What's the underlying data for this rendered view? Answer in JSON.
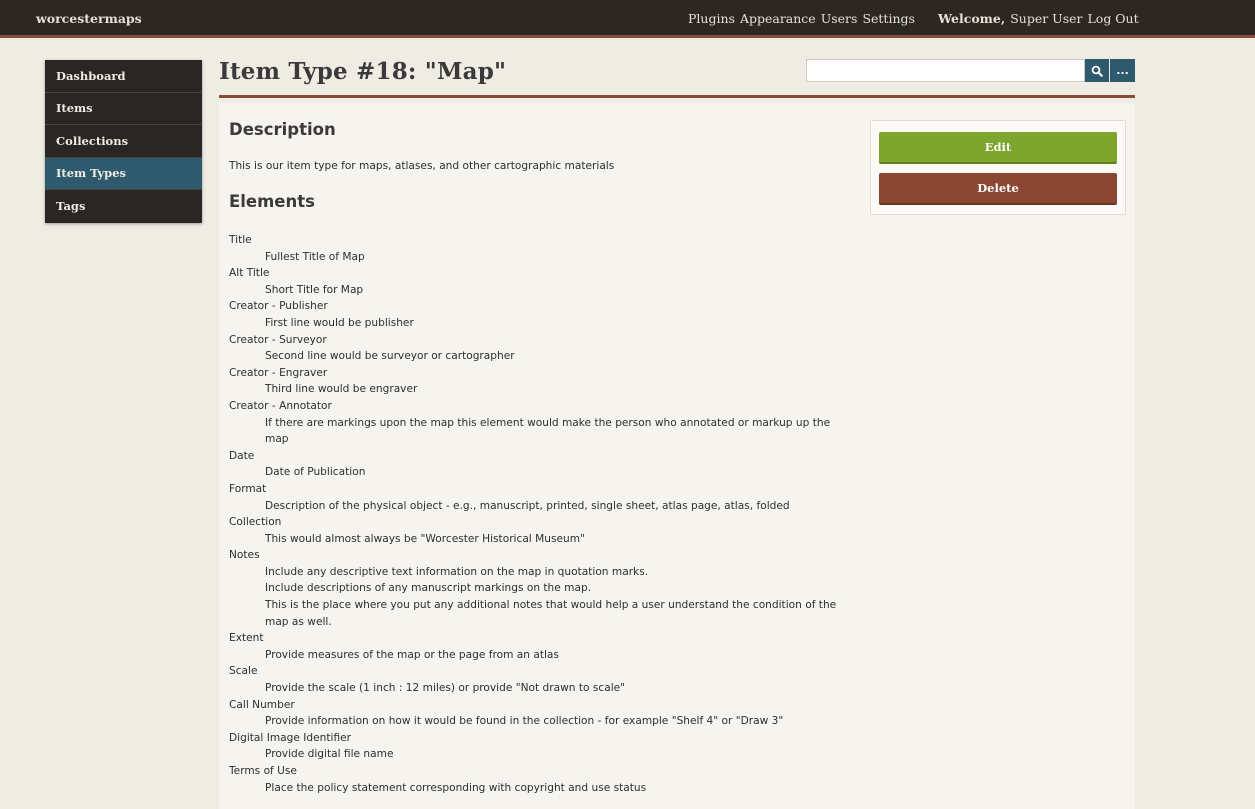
{
  "topbar": {
    "site_title": "worcestermaps",
    "nav": [
      "Plugins",
      "Appearance",
      "Users",
      "Settings"
    ],
    "welcome_bold": "Welcome,",
    "welcome_user": "Super User",
    "logout": "Log Out"
  },
  "sidebar": {
    "items": [
      {
        "label": "Dashboard",
        "active": false
      },
      {
        "label": "Items",
        "active": false
      },
      {
        "label": "Collections",
        "active": false
      },
      {
        "label": "Item Types",
        "active": true
      },
      {
        "label": "Tags",
        "active": false
      }
    ]
  },
  "page": {
    "title": "Item Type #18: \"Map\"",
    "search_placeholder": "",
    "more_label": "..."
  },
  "description": {
    "heading": "Description",
    "text": "This is our item type for maps, atlases, and other cartographic materials"
  },
  "elements": {
    "heading": "Elements",
    "items": [
      {
        "name": "Title",
        "desc": [
          "Fullest Title of Map"
        ]
      },
      {
        "name": "Alt Title",
        "desc": [
          "Short Title for Map"
        ]
      },
      {
        "name": "Creator - Publisher",
        "desc": [
          "First line would be publisher"
        ]
      },
      {
        "name": "Creator - Surveyor",
        "desc": [
          "Second line would be surveyor or cartographer"
        ]
      },
      {
        "name": "Creator - Engraver",
        "desc": [
          "Third line would be engraver"
        ]
      },
      {
        "name": "Creator - Annotator",
        "desc": [
          "If there are markings upon the map this element would make the person who annotated or markup up the",
          "map"
        ]
      },
      {
        "name": "Date",
        "desc": [
          "Date of Publication"
        ]
      },
      {
        "name": "Format",
        "desc": [
          "Description of the physical object - e.g., manuscript, printed, single sheet, atlas page, atlas, folded"
        ]
      },
      {
        "name": "Collection",
        "desc": [
          "This would almost always be \"Worcester Historical Museum\""
        ]
      },
      {
        "name": "Notes",
        "desc": [
          "Include any descriptive text information on the map in quotation marks.",
          "Include descriptions of any manuscript markings on the map.",
          "This is the place where you put any additional notes that would help a user understand the condition of the",
          "map as well."
        ]
      },
      {
        "name": "Extent",
        "desc": [
          "Provide measures of the map or the page from an atlas"
        ]
      },
      {
        "name": "Scale",
        "desc": [
          "Provide the scale (1 inch : 12 miles) or provide \"Not drawn to scale\""
        ]
      },
      {
        "name": "Call Number",
        "desc": [
          "Provide information on how it would be found in the collection - for example \"Shelf 4\" or \"Draw 3\""
        ]
      },
      {
        "name": "Digital Image Identifier",
        "desc": [
          "Provide digital file name"
        ]
      },
      {
        "name": "Terms of Use",
        "desc": [
          "Place the policy statement corresponding with copyright and use status"
        ]
      }
    ]
  },
  "actions": {
    "edit": "Edit",
    "delete": "Delete"
  },
  "colors": {
    "topbar": "#2c2723",
    "accent_rule": "#8a4a35",
    "sidebar_active": "#2f5a6e",
    "edit_button": "#7ea52d",
    "delete_button": "#8a4733"
  }
}
